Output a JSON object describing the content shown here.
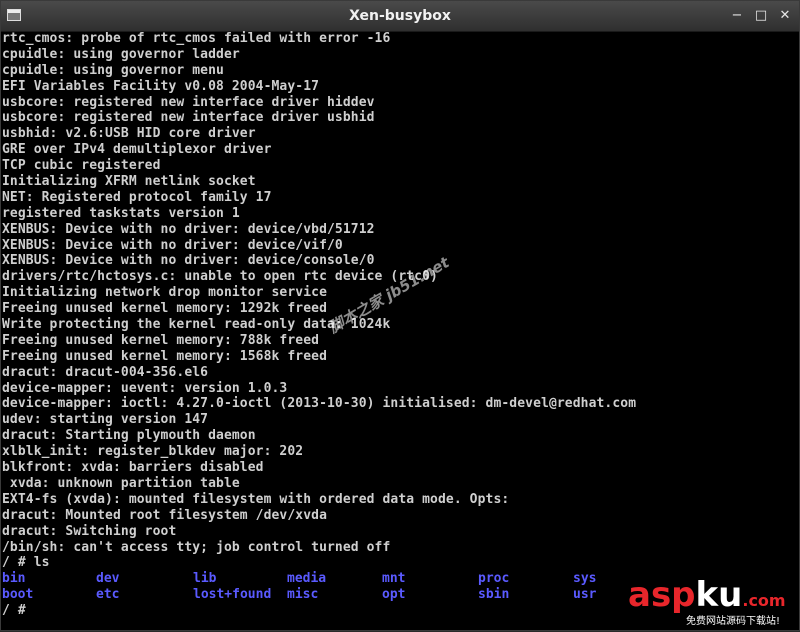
{
  "window": {
    "title": "Xen-busybox",
    "controls": [
      "−",
      "□",
      "✕"
    ],
    "icon": "terminal-window-icon"
  },
  "terminal": {
    "lines": [
      "rtc_cmos: probe of rtc_cmos failed with error -16",
      "cpuidle: using governor ladder",
      "cpuidle: using governor menu",
      "EFI Variables Facility v0.08 2004-May-17",
      "usbcore: registered new interface driver hiddev",
      "usbcore: registered new interface driver usbhid",
      "usbhid: v2.6:USB HID core driver",
      "GRE over IPv4 demultiplexor driver",
      "TCP cubic registered",
      "Initializing XFRM netlink socket",
      "NET: Registered protocol family 17",
      "registered taskstats version 1",
      "XENBUS: Device with no driver: device/vbd/51712",
      "XENBUS: Device with no driver: device/vif/0",
      "XENBUS: Device with no driver: device/console/0",
      "drivers/rtc/hctosys.c: unable to open rtc device (rtc0)",
      "Initializing network drop monitor service",
      "Freeing unused kernel memory: 1292k freed",
      "Write protecting the kernel read-only data: 1024k",
      "Freeing unused kernel memory: 788k freed",
      "Freeing unused kernel memory: 1568k freed",
      "dracut: dracut-004-356.el6",
      "device-mapper: uevent: version 1.0.3",
      "device-mapper: ioctl: 4.27.0-ioctl (2013-10-30) initialised: dm-devel@redhat.com",
      "udev: starting version 147",
      "dracut: Starting plymouth daemon",
      "xlblk_init: register_blkdev major: 202",
      "blkfront: xvda: barriers disabled",
      " xvda: unknown partition table",
      "EXT4-fs (xvda): mounted filesystem with ordered data mode. Opts:",
      "dracut: Mounted root filesystem /dev/xvda",
      "dracut: Switching root",
      "/bin/sh: can't access tty; job control turned off",
      "/ # ls"
    ],
    "ls_rows": [
      [
        "bin",
        "dev",
        "lib",
        "media",
        "mnt",
        "proc",
        "sys"
      ],
      [
        "boot",
        "etc",
        "lost+found",
        "misc",
        "opt",
        "sbin",
        "usr"
      ]
    ],
    "prompt": "/ # "
  },
  "watermark": "脚本之家 jb51.net",
  "logo": {
    "part1": "asp",
    "part2": "ku",
    "part3": ".com",
    "subtitle": "免费网站源码下载站!"
  },
  "colors": {
    "terminal_bg": "#000000",
    "terminal_fg": "#cfcfcf",
    "directory_blue": "#5a5aff",
    "logo_red": "#e8262b"
  }
}
